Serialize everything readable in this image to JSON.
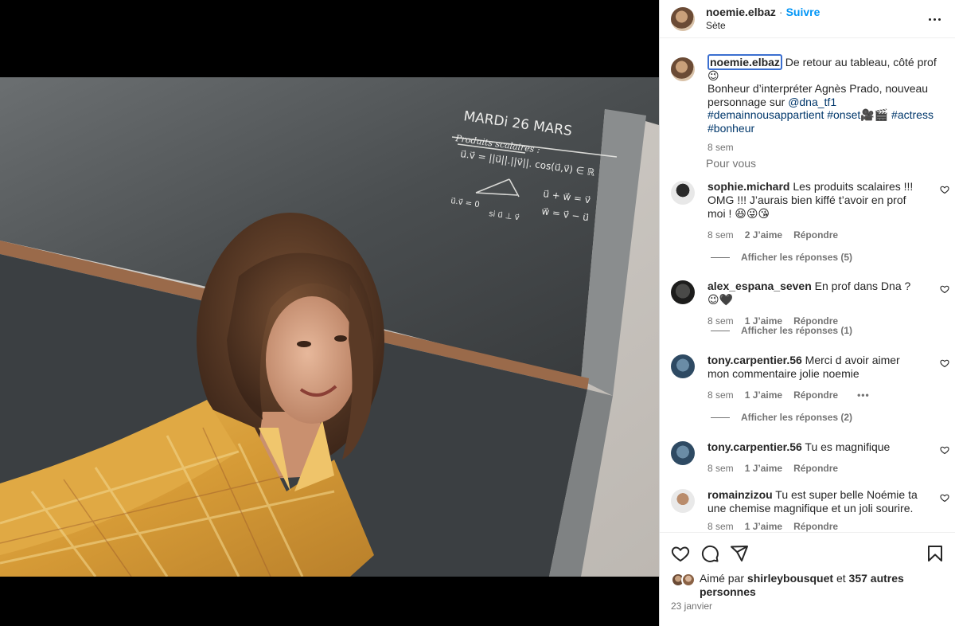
{
  "post": {
    "author": "noemie.elbaz",
    "separator": "·",
    "follow_label": "Suivre",
    "location": "Sète",
    "caption": {
      "username": "noemie.elbaz",
      "text_1": " De retour au tableau, côté prof 😉",
      "text_2": "Bonheur d’interpréter Agnès Prado, nouveau personnage sur ",
      "mention": "@dna_tf1",
      "tag_1": "#demainnousappartient",
      "tag_2": "#onset",
      "emojis_1": "🎥🎬",
      "tag_3": "#actress",
      "tag_4": "#bonheur",
      "age": "8 sem"
    },
    "section_label": "Pour vous",
    "photo": {
      "board_date": "MARDi 26 MARS",
      "board_title": "Produits scalaires :",
      "board_formula": "u⃗.v⃗ = ||u⃗||.||v⃗||. cos(u⃗,v⃗) ∈ ℝ",
      "board_line_a": "u⃗ + w⃗ = v⃗",
      "board_line_b": "w⃗ = v⃗ − u⃗",
      "board_line_c": "u⃗.v⃗ = 0",
      "board_line_d": "si u⃗ ⊥ v⃗"
    }
  },
  "comments": [
    {
      "user": "sophie.michard",
      "text": " Les produits scalaires !!! OMG !!! J’aurais bien kiffé t’avoir en prof moi ! 😆😜😘",
      "age": "8 sem",
      "likes": "2 J’aime",
      "reply": "Répondre",
      "replies": "Afficher les réponses (5)"
    },
    {
      "user": "alex_espana_seven",
      "text": " En prof dans Dna ? 😉🖤",
      "age": "8 sem",
      "likes": "1 J’aime",
      "reply": "Répondre",
      "replies": "Afficher les réponses (1)"
    },
    {
      "user": "tony.carpentier.56",
      "text": " Merci d avoir aimer mon commentaire jolie noemie",
      "age": "8 sem",
      "likes": "1 J’aime",
      "reply": "Répondre",
      "more": "•••",
      "replies": "Afficher les réponses (2)"
    },
    {
      "user": "tony.carpentier.56",
      "text": " Tu es magnifique",
      "age": "8 sem",
      "likes": "1 J’aime",
      "reply": "Répondre"
    },
    {
      "user": "romainzizou",
      "text": " Tu est super belle Noémie ta une chemise magnifique et un joli sourire.",
      "age": "8 sem",
      "likes": "1 J’aime",
      "reply": "Répondre"
    }
  ],
  "likes": {
    "prefix": "Aimé par ",
    "user": "shirleybousquet",
    "middle": " et ",
    "others": "357 autres personnes"
  },
  "date": "23 janvier",
  "colors": {
    "link": "#00376b",
    "follow": "#0095f6",
    "muted": "#737373",
    "shirt": "#d9a441",
    "board": "#3d4246"
  }
}
